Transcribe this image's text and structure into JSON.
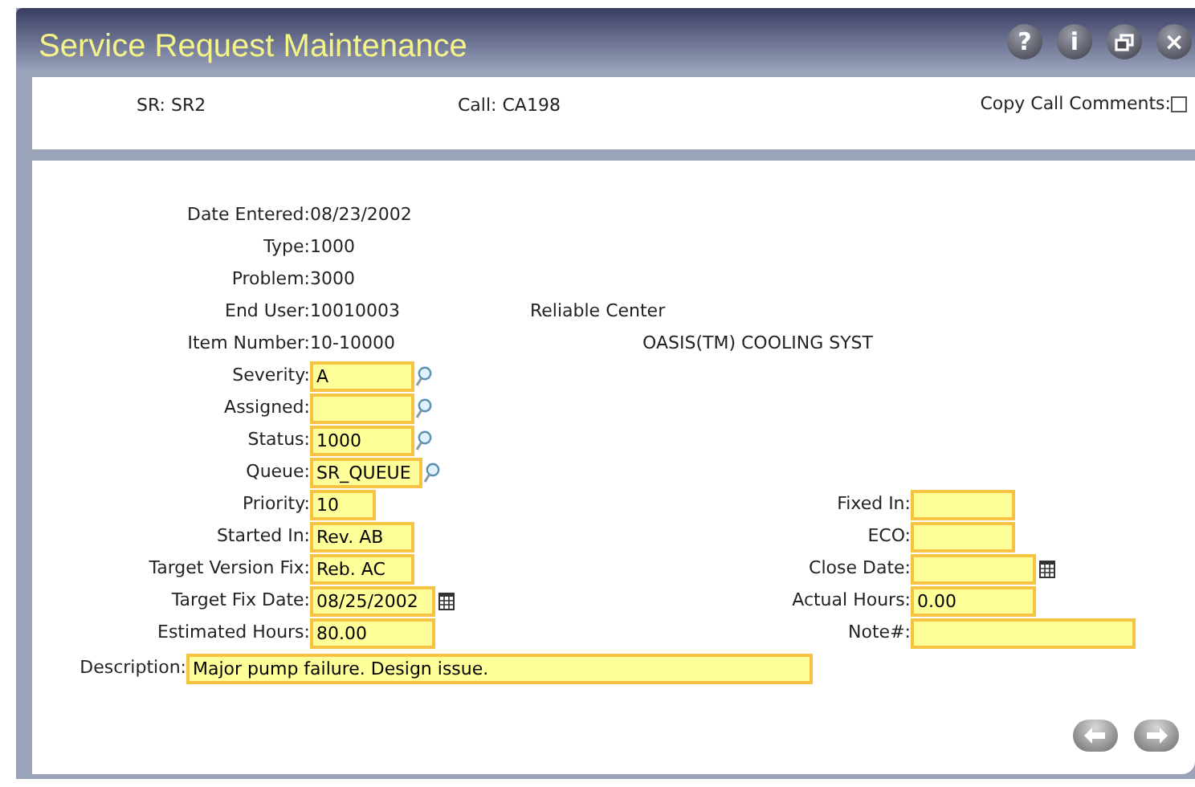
{
  "window": {
    "title": "Service Request Maintenance"
  },
  "title_buttons": [
    {
      "kind": "help",
      "label": "?"
    },
    {
      "kind": "info",
      "label": "i"
    },
    {
      "kind": "restore"
    },
    {
      "kind": "close",
      "label": "×"
    }
  ],
  "header": {
    "sr": {
      "label": "SR:",
      "value": "SR2"
    },
    "call": {
      "label": "Call:",
      "value": "CA198"
    },
    "copy_call_comments": {
      "label": "Copy Call Comments:",
      "checked": false
    }
  },
  "left_fields": [
    {
      "label": "Date Entered:",
      "value": "08/23/2002",
      "kind": "text"
    },
    {
      "label": "Type:",
      "value": "1000",
      "kind": "text"
    },
    {
      "label": "Problem:",
      "value": "3000",
      "kind": "text"
    },
    {
      "label": "End User:",
      "value": "10010003",
      "kind": "text",
      "extra": "Reliable Center"
    },
    {
      "label": "Item Number:",
      "value": "10-10000",
      "kind": "text",
      "extra": "OASIS(TM) COOLING SYST"
    },
    {
      "label": "Severity:",
      "value": "A",
      "kind": "lookup"
    },
    {
      "label": "Assigned:",
      "kind": "lookup"
    },
    {
      "label": "Status:",
      "value": "1000",
      "kind": "lookup"
    },
    {
      "label": "Queue:",
      "value": "SR_QUEUE",
      "kind": "lookup"
    },
    {
      "label": "Priority:",
      "value": "10",
      "kind": "field"
    },
    {
      "label": "Started In:",
      "value": "Rev. AB",
      "kind": "field"
    },
    {
      "label": "Target Version Fix:",
      "value": "Reb. AC",
      "kind": "field"
    },
    {
      "label": "Target Fix Date:",
      "value": "08/25/2002",
      "kind": "date"
    },
    {
      "label": "Estimated Hours:",
      "value": "80.00",
      "kind": "field"
    }
  ],
  "right_fields": [
    {
      "label": "Fixed In:",
      "kind": "field"
    },
    {
      "label": "ECO:",
      "kind": "field"
    },
    {
      "label": "Close Date:",
      "kind": "date"
    },
    {
      "label": "Actual Hours:",
      "value": "0.00",
      "kind": "field"
    },
    {
      "label": "Note#:",
      "kind": "field"
    }
  ],
  "description": {
    "label": "Description:",
    "value": "Major pump failure. Design issue."
  },
  "nav_buttons": [
    {
      "kind": "back"
    },
    {
      "kind": "forward"
    }
  ]
}
